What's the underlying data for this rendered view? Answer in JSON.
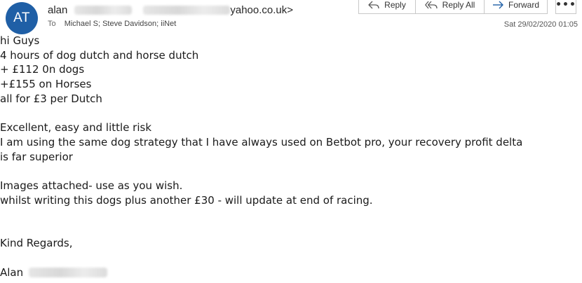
{
  "header": {
    "avatar_initials": "AT",
    "sender_name": "alan",
    "sender_email_tail": "yahoo.co.uk>",
    "to_label": "To",
    "recipients": "Michael S; Steve Davidson; iiNet",
    "timestamp": "Sat 29/02/2020 01:05",
    "avatar_color": "#1f5fa6"
  },
  "toolbar": {
    "reply_label": "Reply",
    "reply_all_label": "Reply All",
    "forward_label": "Forward",
    "more_label": "•••",
    "reply_icon": "reply-icon",
    "reply_all_icon": "reply-all-icon",
    "forward_icon": "forward-icon",
    "accent": "#1f5fa6"
  },
  "message": {
    "lines": [
      "hi Guys",
      "4 hours of dog dutch and horse dutch",
      "+ £112 0n dogs",
      "+£155 on Horses",
      "all for £3 per Dutch"
    ],
    "para2": [
      "Excellent, easy and little risk",
      "I am using the same dog strategy that I have always used on Betbot pro, your recovery profit delta",
      "is far superior"
    ],
    "para3": [
      "Images attached- use as you wish.",
      "whilst writing this dogs plus another £30 - will update at end of racing."
    ],
    "closing": "Kind Regards,",
    "signature_name": "Alan"
  }
}
